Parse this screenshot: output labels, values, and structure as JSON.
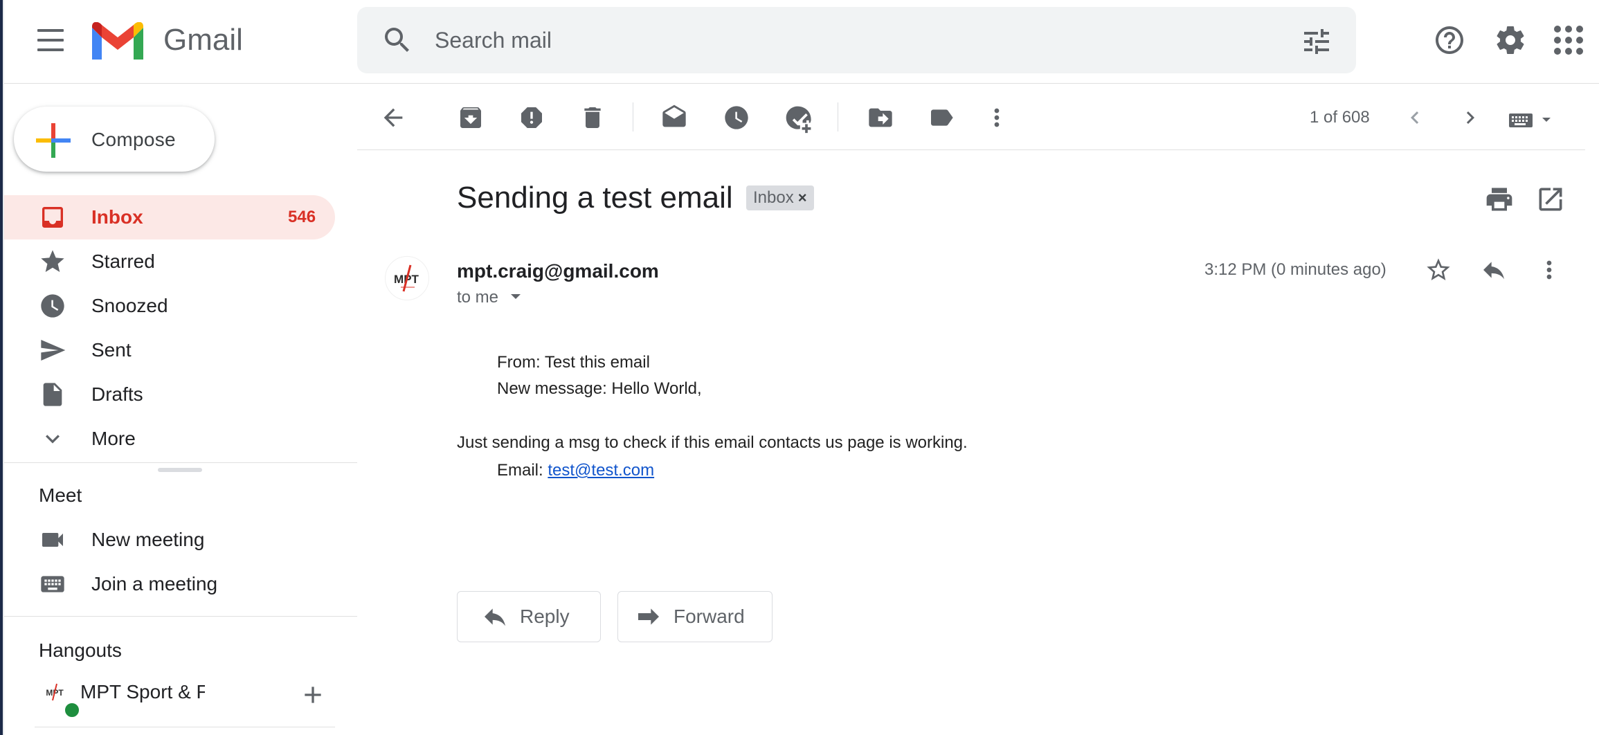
{
  "app": {
    "name": "Gmail"
  },
  "search": {
    "placeholder": "Search mail"
  },
  "compose": {
    "label": "Compose"
  },
  "sidebar": {
    "items": [
      {
        "label": "Inbox",
        "count": "546",
        "icon": "inbox-icon",
        "active": true
      },
      {
        "label": "Starred",
        "icon": "star-icon"
      },
      {
        "label": "Snoozed",
        "icon": "clock-icon"
      },
      {
        "label": "Sent",
        "icon": "send-icon"
      },
      {
        "label": "Drafts",
        "icon": "draft-icon"
      },
      {
        "label": "More",
        "icon": "chevron-down-icon"
      }
    ]
  },
  "meet": {
    "title": "Meet",
    "items": [
      {
        "label": "New meeting",
        "icon": "video-camera-icon"
      },
      {
        "label": "Join a meeting",
        "icon": "keyboard-icon"
      }
    ]
  },
  "hangouts": {
    "title": "Hangouts",
    "contact": {
      "name": "MPT Sport & Fi",
      "status": "online"
    }
  },
  "toolbar": {
    "pager": "1 of 608",
    "icons": [
      "back-arrow-icon",
      "archive-icon",
      "report-spam-icon",
      "delete-icon",
      "mark-unread-icon",
      "snooze-icon",
      "add-to-tasks-icon",
      "move-to-icon",
      "label-icon",
      "more-vert-icon"
    ]
  },
  "message": {
    "subject": "Sending a test email",
    "label": "Inbox",
    "sender": "mpt.craig@gmail.com",
    "recipient": "to me",
    "time": "3:12 PM (0 minutes ago)",
    "body": {
      "from_line": "From: Test this email",
      "new_message_line": "New message: Hello World,",
      "main_line": "Just sending a msg to check if this email contacts us page is working.",
      "email_prefix": "Email:",
      "email_link": "test@test.com"
    }
  },
  "actions": {
    "reply": "Reply",
    "forward": "Forward"
  },
  "colors": {
    "accent": "#d93025",
    "active_bg": "#fce8e6",
    "online": "#1e8e3e",
    "link": "#1155cc"
  }
}
